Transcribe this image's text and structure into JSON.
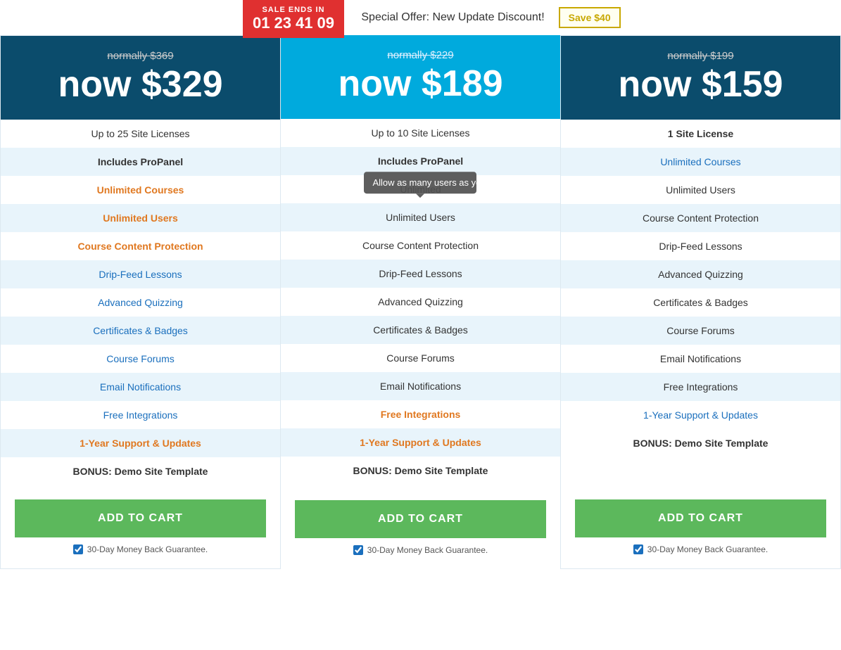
{
  "topbar": {
    "sale_label": "SALE ENDS IN",
    "timer": [
      "01",
      "23",
      "41",
      "09"
    ],
    "special_offer": "Special Offer: New Update Discount!",
    "save_badge": "Save $40"
  },
  "plans": [
    {
      "id": "plan-25",
      "original_price": "normally $369",
      "current_price": "now $329",
      "features": [
        {
          "text": "Up to 25 Site Licenses",
          "style": "normal"
        },
        {
          "text": "Includes ProPanel",
          "style": "bold"
        },
        {
          "text": "Unlimited Courses",
          "style": "highlight-orange"
        },
        {
          "text": "Unlimited Users",
          "style": "highlight-orange"
        },
        {
          "text": "Course Content Protection",
          "style": "highlight-orange"
        },
        {
          "text": "Drip-Feed Lessons",
          "style": "highlight-blue"
        },
        {
          "text": "Advanced Quizzing",
          "style": "highlight-blue"
        },
        {
          "text": "Certificates & Badges",
          "style": "highlight-blue"
        },
        {
          "text": "Course Forums",
          "style": "highlight-blue"
        },
        {
          "text": "Email Notifications",
          "style": "highlight-blue"
        },
        {
          "text": "Free Integrations",
          "style": "highlight-blue"
        },
        {
          "text": "1-Year Support & Updates",
          "style": "highlight-orange"
        },
        {
          "text": "BONUS: Demo Site Template",
          "style": "bonus"
        }
      ],
      "button_label": "ADD TO CART",
      "guarantee": "30-Day Money Back Guarantee."
    },
    {
      "id": "plan-10",
      "featured": true,
      "original_price": "normally $229",
      "current_price": "now $189",
      "features": [
        {
          "text": "Up to 10 Site Licenses",
          "style": "normal"
        },
        {
          "text": "Includes ProPanel",
          "style": "bold"
        },
        {
          "text": "Unlimited Courses",
          "style": "highlight-orange",
          "tooltip": "Allow as many users as you want."
        },
        {
          "text": "Unlimited Users",
          "style": "normal"
        },
        {
          "text": "Course Content Protection",
          "style": "normal"
        },
        {
          "text": "Drip-Feed Lessons",
          "style": "normal"
        },
        {
          "text": "Advanced Quizzing",
          "style": "normal"
        },
        {
          "text": "Certificates & Badges",
          "style": "normal"
        },
        {
          "text": "Course Forums",
          "style": "normal"
        },
        {
          "text": "Email Notifications",
          "style": "normal"
        },
        {
          "text": "Free Integrations",
          "style": "highlight-orange"
        },
        {
          "text": "1-Year Support & Updates",
          "style": "highlight-orange"
        },
        {
          "text": "BONUS: Demo Site Template",
          "style": "bonus"
        }
      ],
      "button_label": "ADD TO CART",
      "guarantee": "30-Day Money Back Guarantee."
    },
    {
      "id": "plan-1",
      "original_price": "normally $199",
      "current_price": "now $159",
      "features": [
        {
          "text": "1 Site License",
          "style": "bold"
        },
        {
          "text": "Unlimited Courses",
          "style": "highlight-blue"
        },
        {
          "text": "Unlimited Users",
          "style": "normal"
        },
        {
          "text": "Course Content Protection",
          "style": "normal"
        },
        {
          "text": "Drip-Feed Lessons",
          "style": "normal"
        },
        {
          "text": "Advanced Quizzing",
          "style": "normal"
        },
        {
          "text": "Certificates & Badges",
          "style": "normal"
        },
        {
          "text": "Course Forums",
          "style": "normal"
        },
        {
          "text": "Email Notifications",
          "style": "normal"
        },
        {
          "text": "Free Integrations",
          "style": "normal"
        },
        {
          "text": "1-Year Support & Updates",
          "style": "highlight-blue"
        },
        {
          "text": "BONUS: Demo Site Template",
          "style": "bonus"
        }
      ],
      "button_label": "ADD TO CART",
      "guarantee": "30-Day Money Back Guarantee."
    }
  ],
  "tooltip_text": "Allow as many users as you want."
}
